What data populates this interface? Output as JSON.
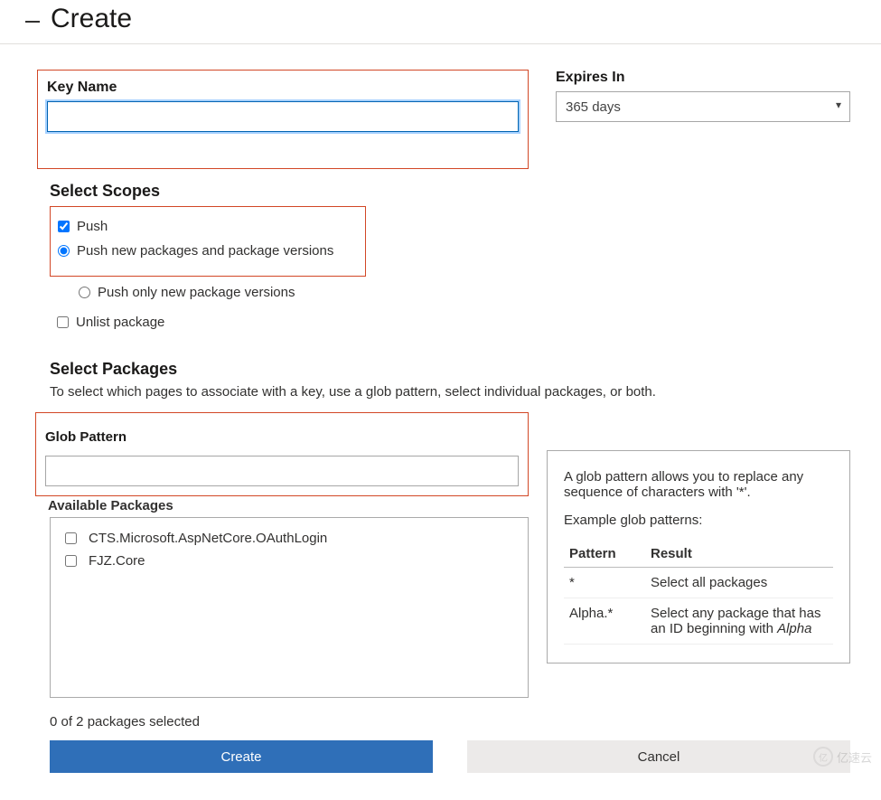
{
  "header": {
    "title": "Create"
  },
  "keyName": {
    "label": "Key Name",
    "value": ""
  },
  "expires": {
    "label": "Expires In",
    "value": "365 days"
  },
  "scopes": {
    "title": "Select Scopes",
    "push": {
      "label": "Push",
      "checked": true
    },
    "pushNew": {
      "label": "Push new packages and package versions",
      "checked": true
    },
    "pushOnly": {
      "label": "Push only new package versions",
      "checked": false
    },
    "unlist": {
      "label": "Unlist package",
      "checked": false
    }
  },
  "packages": {
    "title": "Select Packages",
    "desc": "To select which pages to associate with a key, use a glob pattern, select individual packages, or both.",
    "globLabel": "Glob Pattern",
    "globValue": "",
    "availableLabel": "Available Packages",
    "items": [
      {
        "name": "CTS.Microsoft.AspNetCore.OAuthLogin",
        "checked": false
      },
      {
        "name": "FJZ.Core",
        "checked": false
      }
    ],
    "status": "0 of 2 packages selected"
  },
  "help": {
    "p1": "A glob pattern allows you to replace any sequence of characters with '*'.",
    "p2": "Example glob patterns:",
    "colPattern": "Pattern",
    "colResult": "Result",
    "rows": [
      {
        "pattern": "*",
        "result": "Select all packages"
      },
      {
        "pattern": "Alpha.*",
        "result": "Select any package that has an ID beginning with ",
        "em": "Alpha"
      }
    ]
  },
  "buttons": {
    "create": "Create",
    "cancel": "Cancel"
  },
  "watermark": "亿速云"
}
